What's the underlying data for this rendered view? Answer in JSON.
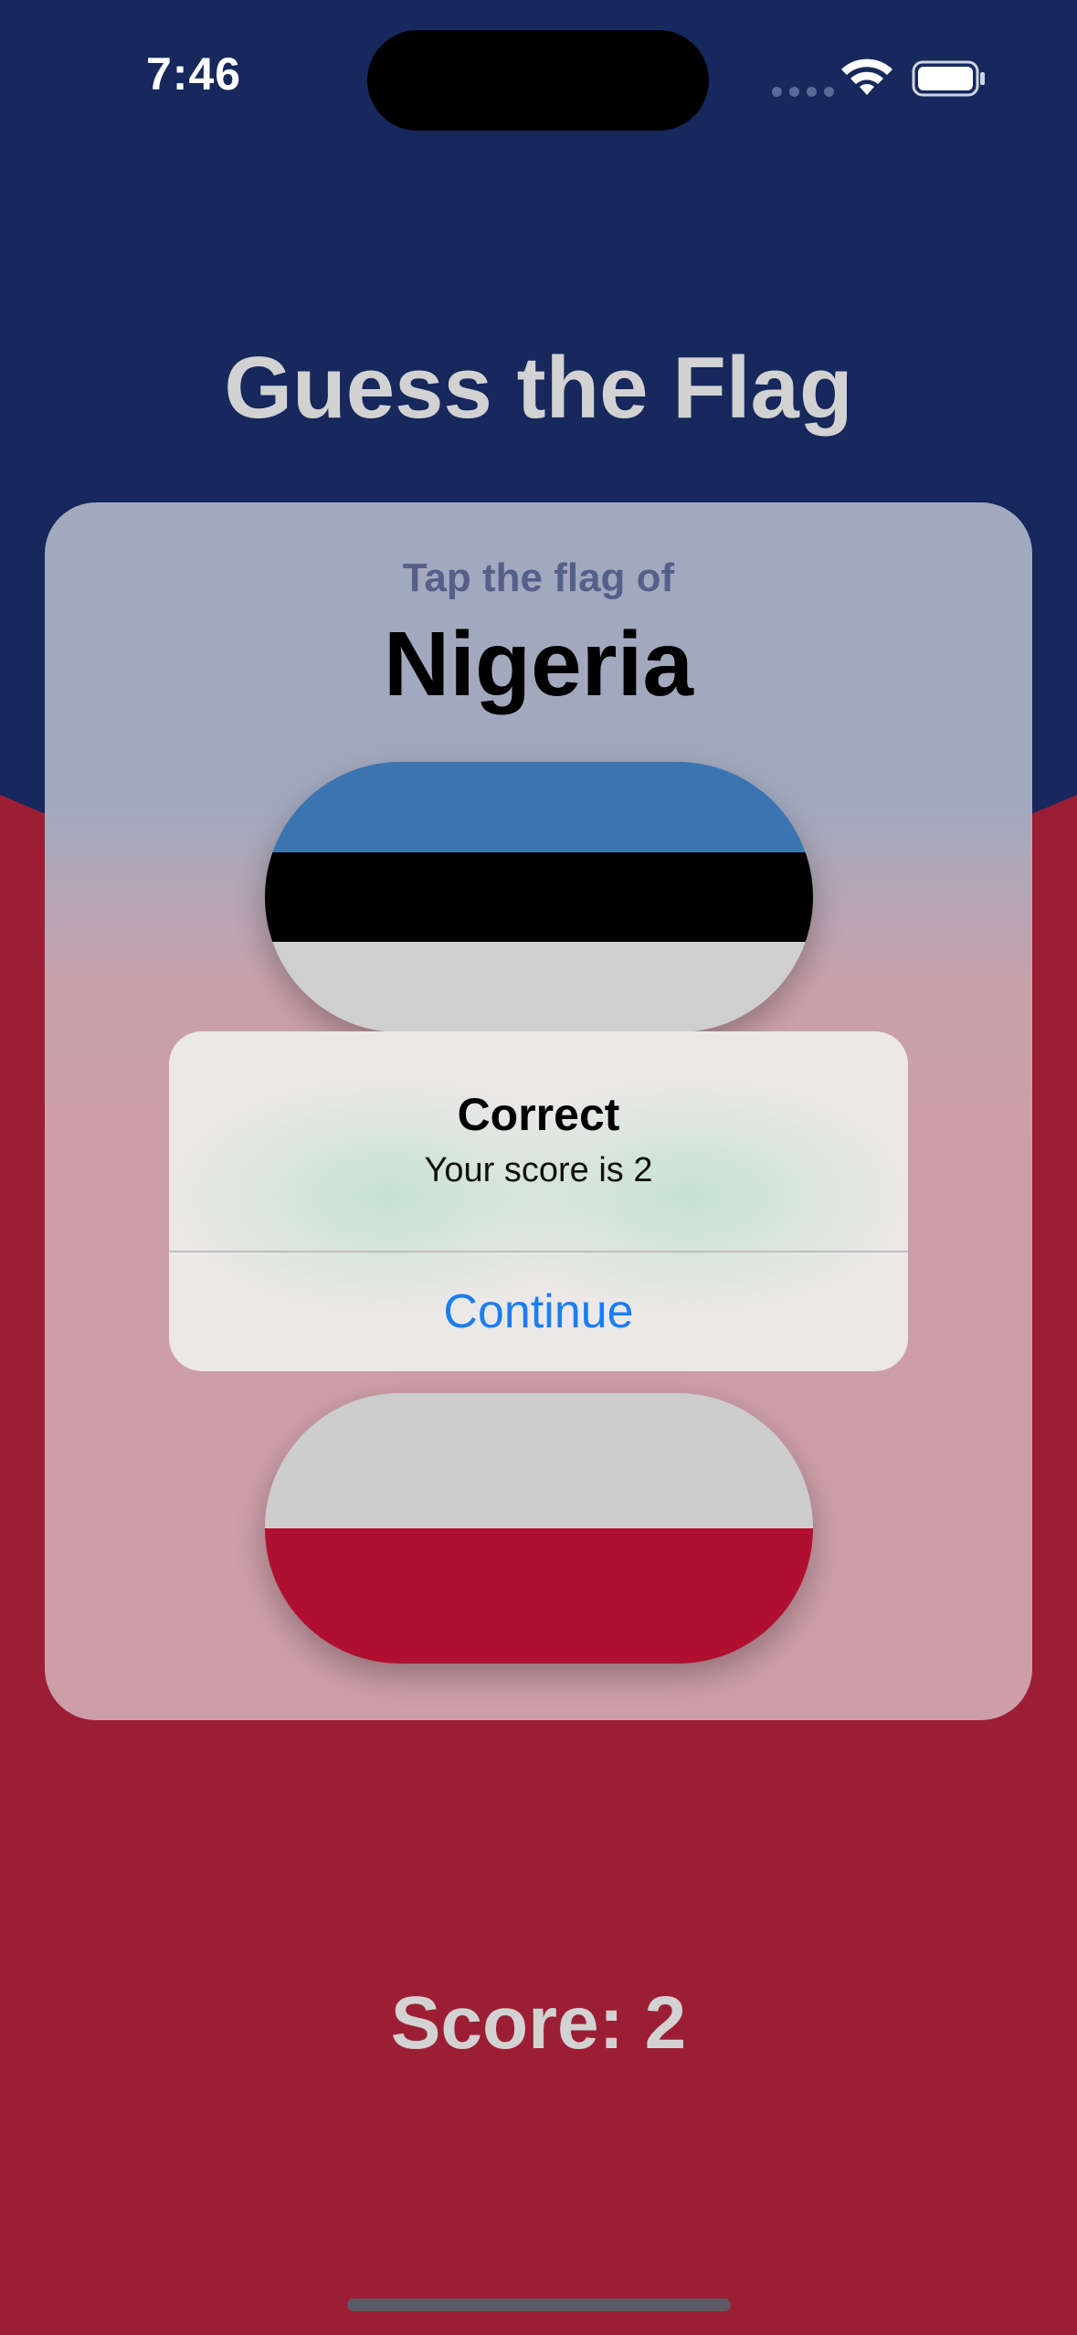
{
  "status_bar": {
    "time": "7:46",
    "icons": [
      "cellular-signal-icon",
      "wifi-icon",
      "battery-icon"
    ]
  },
  "app": {
    "title": "Guess the Flag",
    "prompt": "Tap the flag of",
    "country": "Nigeria"
  },
  "flags": [
    {
      "name": "Estonia",
      "stripes": [
        "#3b75b1",
        "#000000",
        "#cfcfcf"
      ]
    },
    {
      "name": "Poland",
      "stripes": [
        "#cdcdcd",
        "#b01030"
      ]
    }
  ],
  "alert": {
    "title": "Correct",
    "message": "Your score is 2",
    "button_label": "Continue"
  },
  "score": {
    "label": "Score: 2"
  },
  "colors": {
    "background_top": "#16285c",
    "background_bottom": "#9c1e34",
    "accent": "#1a7ef2"
  }
}
